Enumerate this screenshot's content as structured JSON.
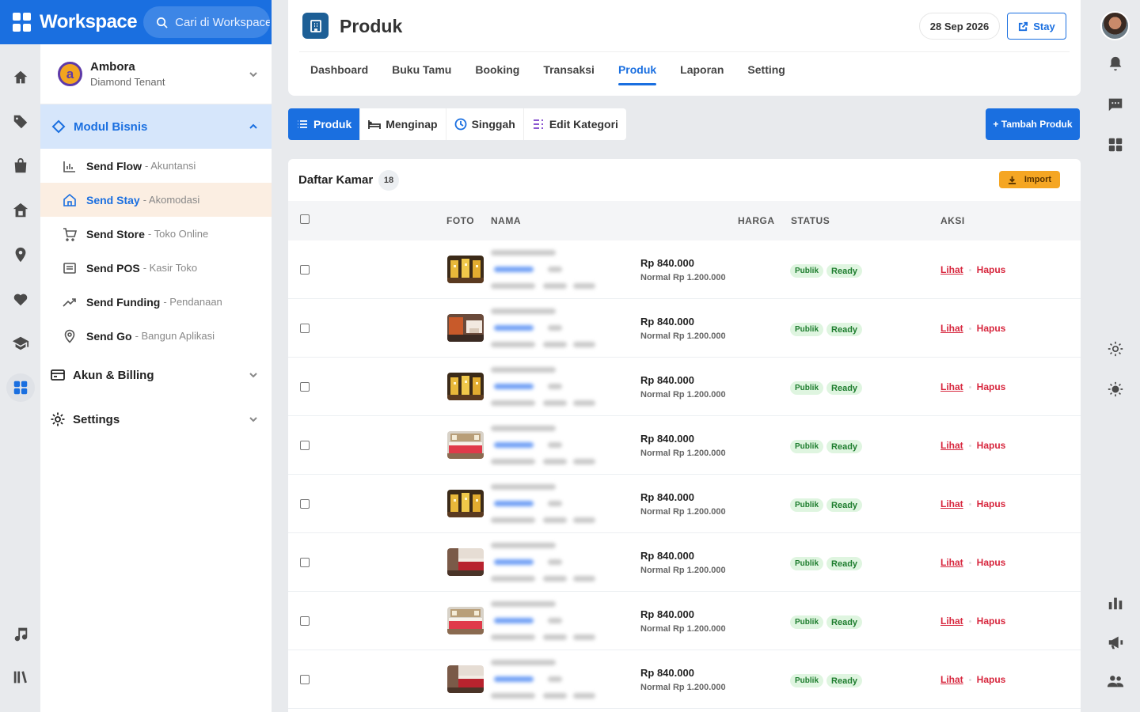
{
  "brand": {
    "title": "Workspace",
    "search_placeholder": "Cari di Workspace"
  },
  "tenant": {
    "initial": "a",
    "name": "Ambora",
    "plan": "Diamond Tenant"
  },
  "sidebar": {
    "module_title": "Modul Bisnis",
    "items": [
      {
        "name": "Send Flow",
        "desc": "- Akuntansi"
      },
      {
        "name": "Send Stay",
        "desc": "- Akomodasi"
      },
      {
        "name": "Send Store",
        "desc": "- Toko Online"
      },
      {
        "name": "Send POS",
        "desc": "- Kasir Toko"
      },
      {
        "name": "Send Funding",
        "desc": "- Pendanaan"
      },
      {
        "name": "Send Go",
        "desc": "- Bangun Aplikasi"
      }
    ],
    "billing": "Akun & Billing",
    "settings": "Settings"
  },
  "header": {
    "title": "Produk",
    "date": "28 Sep 2026",
    "stay_label": "Stay",
    "tabs": [
      "Dashboard",
      "Buku Tamu",
      "Booking",
      "Transaksi",
      "Produk",
      "Laporan",
      "Setting"
    ]
  },
  "subtabs": [
    "Produk",
    "Menginap",
    "Singgah",
    "Edit Kategori"
  ],
  "add_button": "+ Tambah Produk",
  "list": {
    "title": "Daftar Kamar",
    "count": "18",
    "import_label": "Import",
    "columns": {
      "foto": "FOTO",
      "nama": "NAMA",
      "harga": "HARGA",
      "status": "STATUS",
      "aksi": "AKSI"
    },
    "rows": [
      {
        "price": "Rp 840.000",
        "normal": "Normal Rp 1.200.000",
        "status1": "Publik",
        "status2": "Ready",
        "view": "Lihat",
        "delete": "Hapus",
        "photo": "lamps"
      },
      {
        "price": "Rp 840.000",
        "normal": "Normal Rp 1.200.000",
        "status1": "Publik",
        "status2": "Ready",
        "view": "Lihat",
        "delete": "Hapus",
        "photo": "room"
      },
      {
        "price": "Rp 840.000",
        "normal": "Normal Rp 1.200.000",
        "status1": "Publik",
        "status2": "Ready",
        "view": "Lihat",
        "delete": "Hapus",
        "photo": "lamps"
      },
      {
        "price": "Rp 840.000",
        "normal": "Normal Rp 1.200.000",
        "status1": "Publik",
        "status2": "Ready",
        "view": "Lihat",
        "delete": "Hapus",
        "photo": "bed"
      },
      {
        "price": "Rp 840.000",
        "normal": "Normal Rp 1.200.000",
        "status1": "Publik",
        "status2": "Ready",
        "view": "Lihat",
        "delete": "Hapus",
        "photo": "lamps"
      },
      {
        "price": "Rp 840.000",
        "normal": "Normal Rp 1.200.000",
        "status1": "Publik",
        "status2": "Ready",
        "view": "Lihat",
        "delete": "Hapus",
        "photo": "red"
      },
      {
        "price": "Rp 840.000",
        "normal": "Normal Rp 1.200.000",
        "status1": "Publik",
        "status2": "Ready",
        "view": "Lihat",
        "delete": "Hapus",
        "photo": "bed"
      },
      {
        "price": "Rp 840.000",
        "normal": "Normal Rp 1.200.000",
        "status1": "Publik",
        "status2": "Ready",
        "view": "Lihat",
        "delete": "Hapus",
        "photo": "red"
      }
    ]
  },
  "left_rail_icons": [
    "home-icon",
    "tag-icon",
    "bag-icon",
    "house-icon",
    "location-icon",
    "heart-icon",
    "school-icon",
    "apps-icon",
    "music-icon",
    "library-icon"
  ],
  "right_rail_icons": [
    "user-avatar",
    "bell-icon",
    "chat-icon",
    "apps-icon",
    "gear-icon",
    "brightness-icon",
    "chart-icon",
    "megaphone-icon",
    "people-icon"
  ],
  "colors": {
    "primary": "#1a6fe0",
    "danger": "#d7263d",
    "success_bg": "#dff5e0",
    "warning": "#f5a623"
  }
}
